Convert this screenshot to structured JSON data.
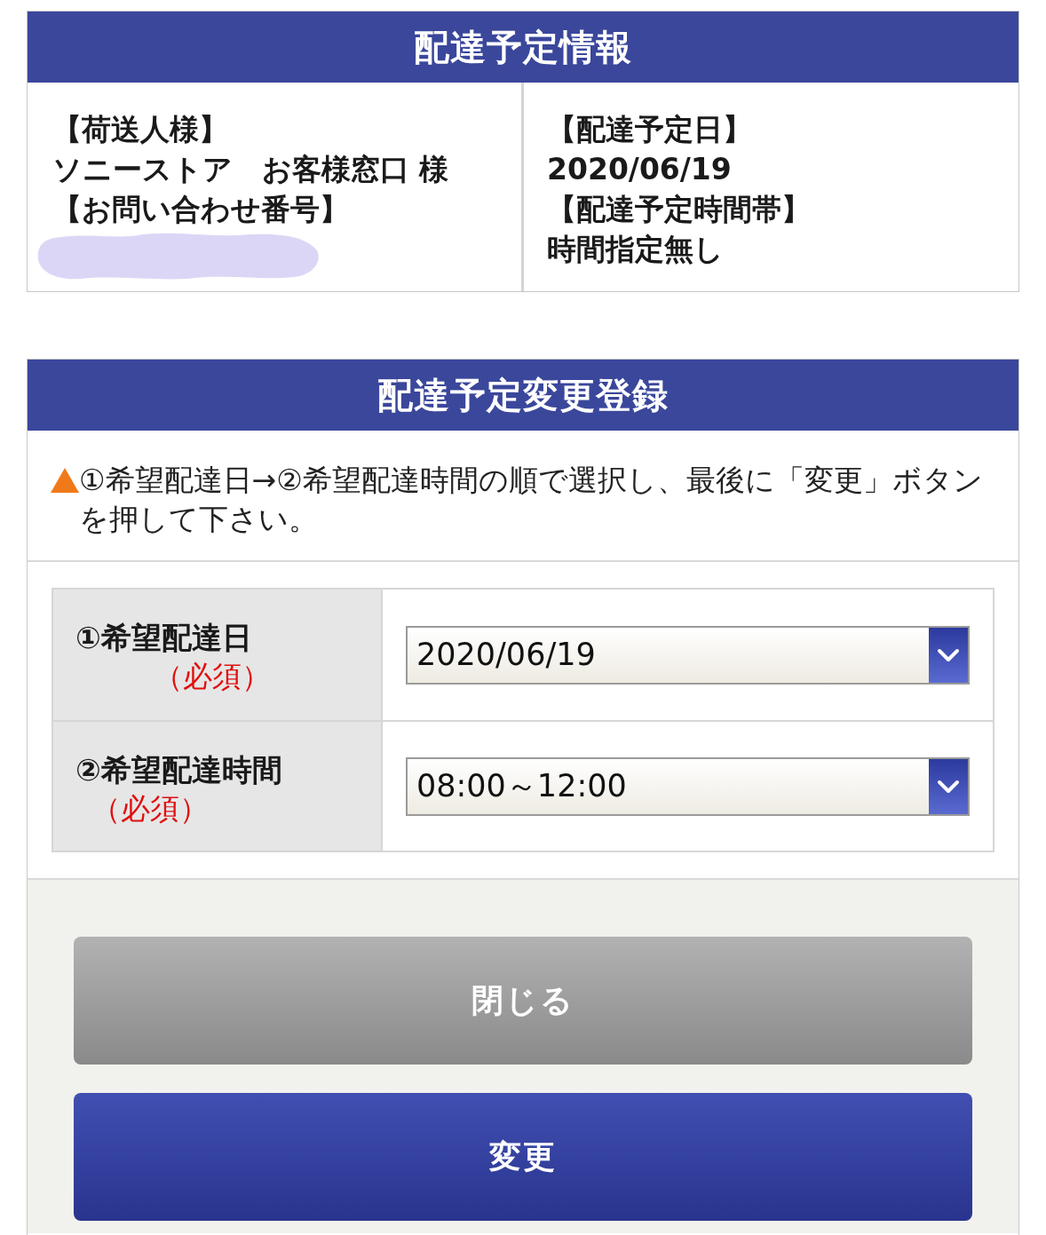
{
  "info_panel": {
    "title": "配達予定情報",
    "shipper": {
      "label": "【荷送人様】",
      "value": "ソニーストア　お客様窓口 様"
    },
    "tracking": {
      "label": "【お問い合わせ番号】",
      "redacted": true
    },
    "delivery_date": {
      "label": "【配達予定日】",
      "value": "2020/06/19"
    },
    "time_slot": {
      "label": "【配達予定時間帯】",
      "value": "時間指定無し"
    }
  },
  "change_form": {
    "title": "配達予定変更登録",
    "notice": "①希望配達日→②希望配達時間の順で選択し、最後に「変更」ボタンを押して下さい。",
    "fields": [
      {
        "label": "①希望配達日",
        "required": "（必須）",
        "value": "2020/06/19"
      },
      {
        "label": "②希望配達時間",
        "required": "（必須）",
        "value": "08:00～12:00"
      }
    ],
    "buttons": [
      {
        "label": "閉じる",
        "kind": "secondary"
      },
      {
        "label": "変更",
        "kind": "primary"
      }
    ]
  }
}
